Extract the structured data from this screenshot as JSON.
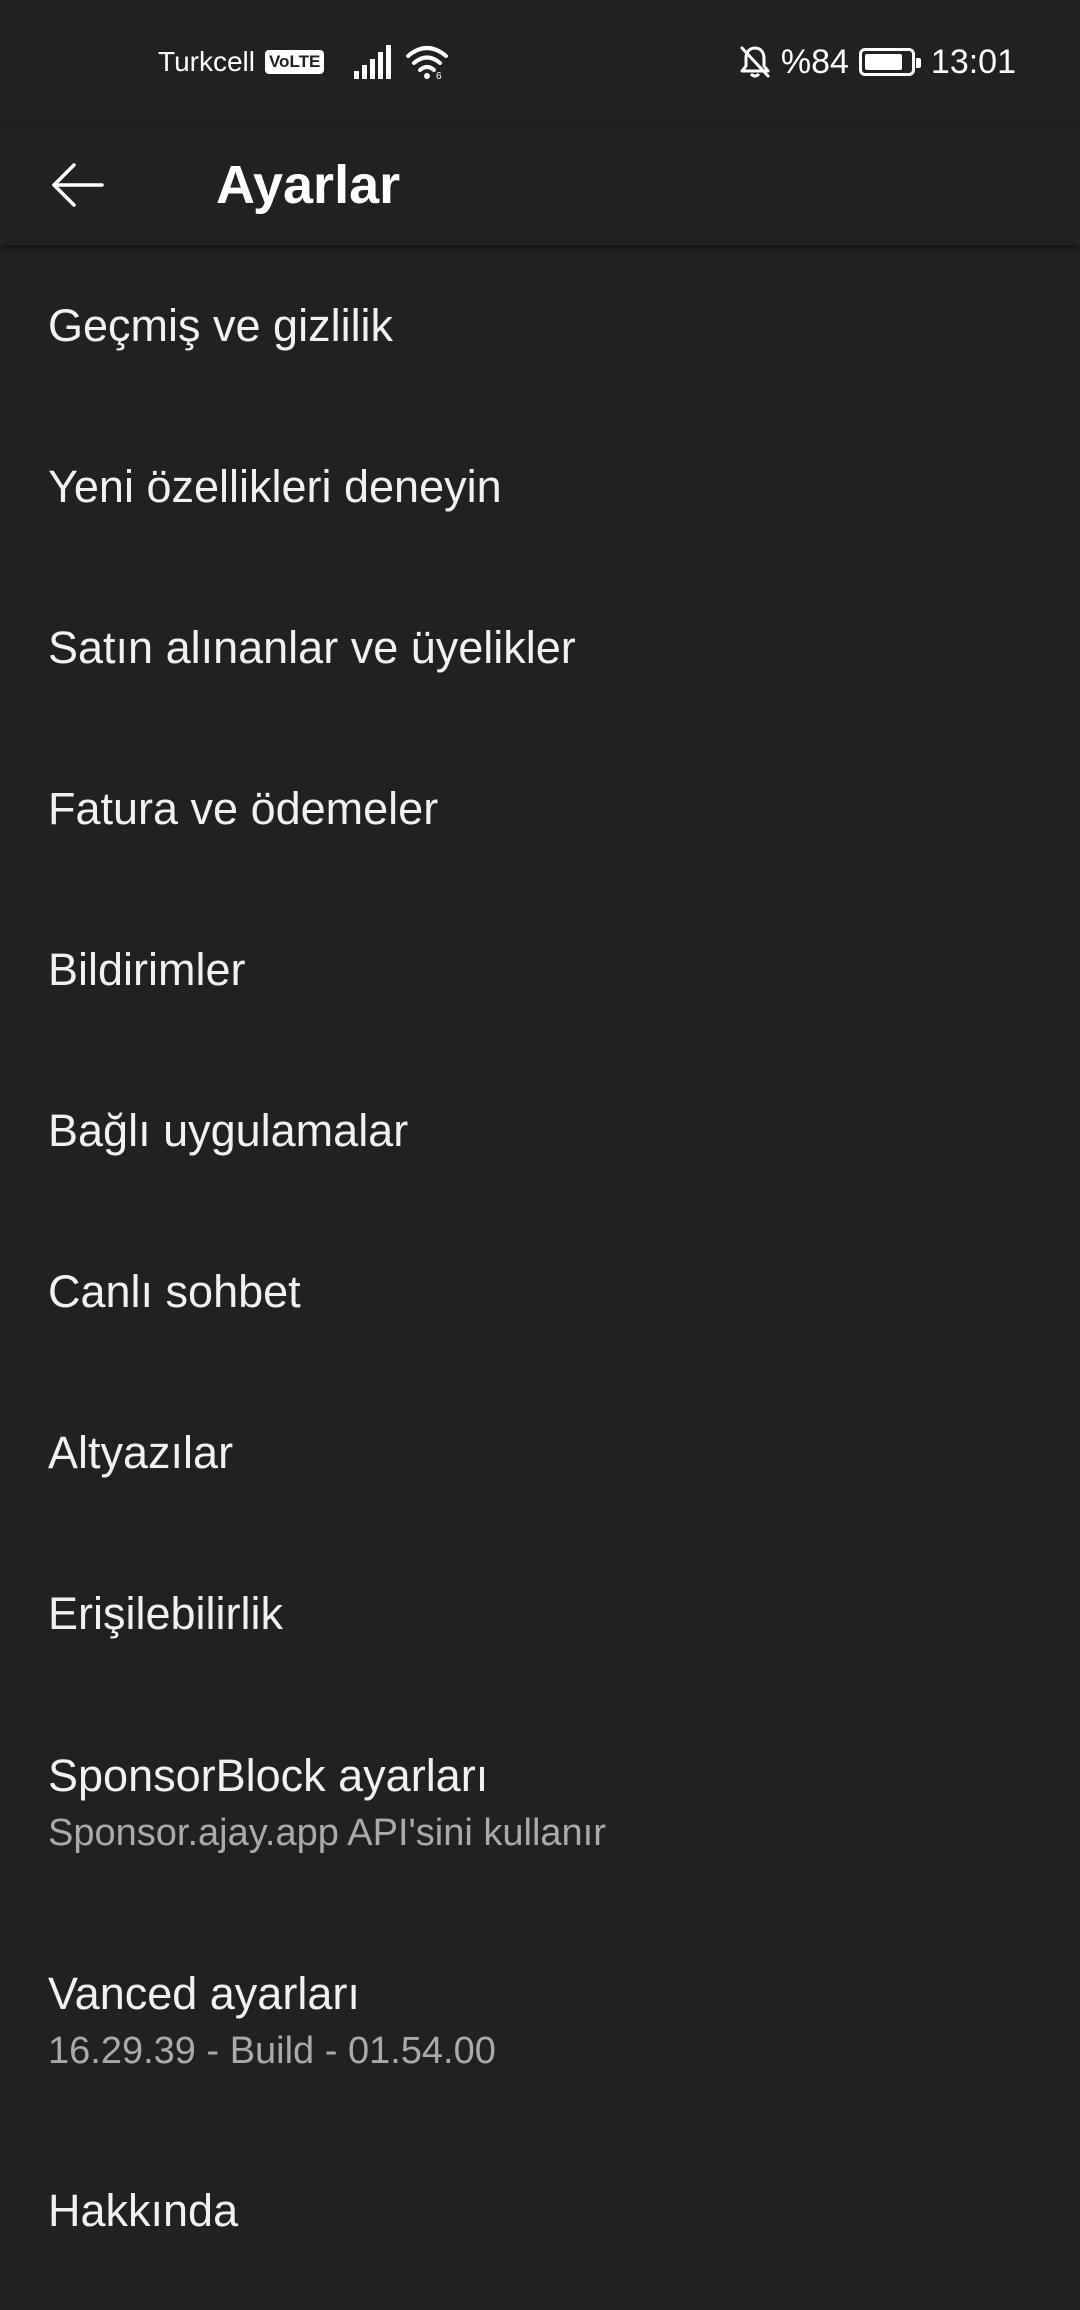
{
  "status_bar": {
    "carrier": "Turkcell",
    "volte_badge": "VoLTE",
    "battery_text": "%84",
    "battery_level": 0.84,
    "time": "13:01"
  },
  "app_bar": {
    "title": "Ayarlar",
    "back_icon": "arrow-back-icon"
  },
  "settings": {
    "items": [
      {
        "title": "Geçmiş ve gizlilik"
      },
      {
        "title": "Yeni özellikleri deneyin"
      },
      {
        "title": "Satın alınanlar ve üyelikler"
      },
      {
        "title": "Fatura ve ödemeler"
      },
      {
        "title": "Bildirimler"
      },
      {
        "title": "Bağlı uygulamalar"
      },
      {
        "title": "Canlı sohbet"
      },
      {
        "title": "Altyazılar"
      },
      {
        "title": "Erişilebilirlik"
      },
      {
        "title": "SponsorBlock ayarları",
        "subtitle": "Sponsor.ajay.app API'sini kullanır"
      },
      {
        "title": "Vanced ayarları",
        "subtitle": "16.29.39 - Build - 01.54.00"
      },
      {
        "title": "Hakkında"
      }
    ]
  },
  "colors": {
    "background": "#212121",
    "text_primary": "#f1f1f1",
    "text_secondary": "#aaaaaa"
  }
}
